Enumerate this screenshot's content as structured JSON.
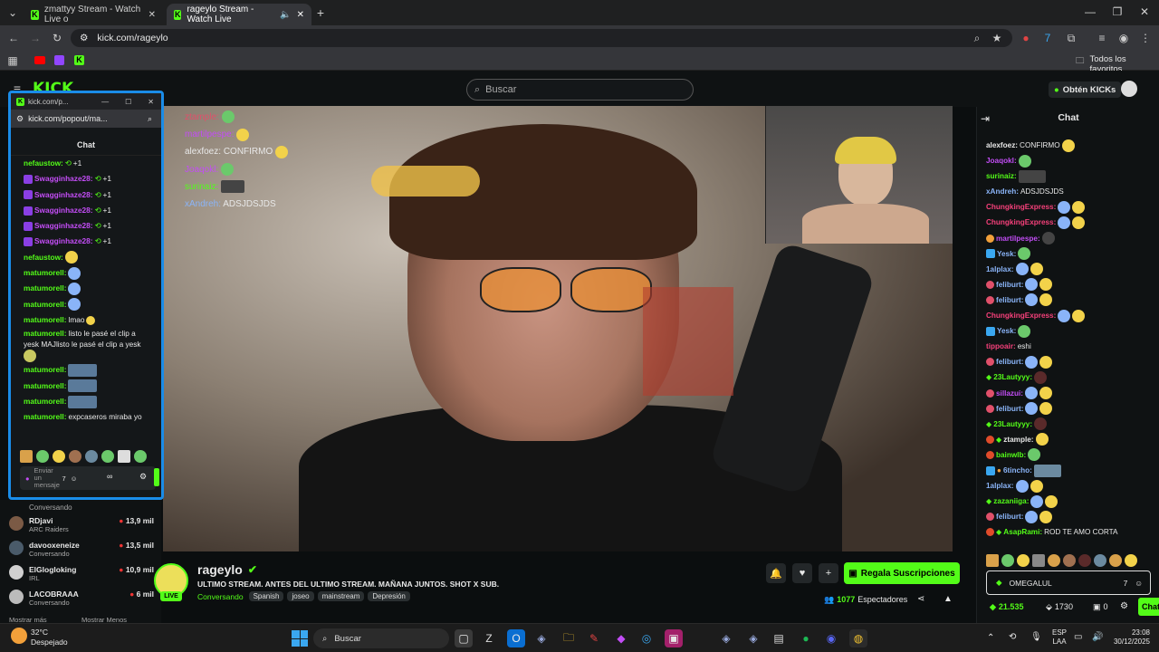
{
  "browser": {
    "tabs": [
      {
        "title": "zmattyy Stream - Watch Live o"
      },
      {
        "title": "rageylo Stream - Watch Live"
      }
    ],
    "url": "kick.com/rageylo",
    "favorites_label": "Todos los favoritos"
  },
  "site": {
    "search_placeholder": "Buscar",
    "get_kicks_label": "Obtén KICKs",
    "logo_text": "KICK"
  },
  "popout": {
    "title": "kick.com/p...",
    "url": "kick.com/popout/ma...",
    "chat_header": "Chat",
    "messages": [
      {
        "user": "nefaustow:",
        "color": "#53fc18",
        "text": "+1",
        "badge": false
      },
      {
        "user": "Swagginhaze28:",
        "color": "#c34df6",
        "text": "+1",
        "badge": true
      },
      {
        "user": "Swagginhaze28:",
        "color": "#c34df6",
        "text": "+1",
        "badge": true
      },
      {
        "user": "Swagginhaze28:",
        "color": "#c34df6",
        "text": "+1",
        "badge": true
      },
      {
        "user": "Swagginhaze28:",
        "color": "#c34df6",
        "text": "+1",
        "badge": true
      },
      {
        "user": "Swagginhaze28:",
        "color": "#c34df6",
        "text": "+1",
        "badge": true
      },
      {
        "user": "nefaustow:",
        "color": "#53fc18",
        "text": "",
        "badge": false
      },
      {
        "user": "matumorell:",
        "color": "#53fc18",
        "text": "",
        "badge": false
      },
      {
        "user": "matumorell:",
        "color": "#53fc18",
        "text": "",
        "badge": false
      },
      {
        "user": "matumorell:",
        "color": "#53fc18",
        "text": "",
        "badge": false
      },
      {
        "user": "matumorell:",
        "color": "#53fc18",
        "text": "lmao",
        "badge": false
      },
      {
        "user": "matumorell:",
        "color": "#53fc18",
        "text": "listo le pasé el clip a",
        "badge": false
      },
      {
        "user": "",
        "color": "#53fc18",
        "text": "yesk MAJlisto le pasé el clip a yesk",
        "badge": false
      },
      {
        "user": "",
        "color": "#53fc18",
        "text": "",
        "badge": false
      },
      {
        "user": "matumorell:",
        "color": "#53fc18",
        "text": "",
        "badge": false
      },
      {
        "user": "matumorell:",
        "color": "#53fc18",
        "text": "",
        "badge": false
      },
      {
        "user": "matumorell:",
        "color": "#53fc18",
        "text": "",
        "badge": false
      },
      {
        "user": "matumorell:",
        "color": "#53fc18",
        "text": "expcaseros miraba yo",
        "badge": false
      }
    ],
    "input_placeholder": "Enviar un mensaje"
  },
  "overlay_chat": [
    {
      "user": "ztample:",
      "color": "#e0506a",
      "text": ""
    },
    {
      "user": "martilpespe:",
      "color": "#c34df6",
      "text": ""
    },
    {
      "user": "alexfoez:",
      "color": "#e8e8e8",
      "text": "CONFIRMO"
    },
    {
      "user": "Joaqokl:",
      "color": "#c34df6",
      "text": ""
    },
    {
      "user": "surinaiz:",
      "color": "#53fc18",
      "text": ""
    },
    {
      "user": "xAndreh:",
      "color": "#8ab4f8",
      "text": "ADSJDSJDS"
    }
  ],
  "sidebar": {
    "channels": [
      {
        "name": "",
        "category": "Conversando",
        "viewers": ""
      },
      {
        "name": "RDjavi",
        "category": "ARC Raiders",
        "viewers": "13,9 mil"
      },
      {
        "name": "davooxeneize",
        "category": "Conversando",
        "viewers": "13,5 mil"
      },
      {
        "name": "ElGlogloking",
        "category": "IRL",
        "viewers": "10,9 mil"
      },
      {
        "name": "LACOBRAAA",
        "category": "Conversando",
        "viewers": "6 mil"
      }
    ],
    "show_more": "Mostrar más",
    "show_less": "Mostrar Menos"
  },
  "stream": {
    "streamer": "rageylo",
    "live_badge": "LIVE",
    "title": "ULTIMO STREAM. ANTES DEL ULTIMO STREAM. MAÑANA JUNTOS. SHOT X SUB.",
    "category": "Conversando",
    "tags": [
      "Spanish",
      "joseo",
      "mainstream",
      "Depresión"
    ],
    "gift_label": "Regala Suscripciones",
    "viewers_count": "1077",
    "viewers_label": "Espectadores"
  },
  "chat": {
    "header": "Chat",
    "messages": [
      {
        "user": "alexfoez:",
        "color": "#e8e8e8",
        "text": "CONFIRMO"
      },
      {
        "user": "Joaqokl:",
        "color": "#c34df6",
        "text": ""
      },
      {
        "user": "surinaiz:",
        "color": "#53fc18",
        "text": ""
      },
      {
        "user": "xAndreh:",
        "color": "#8ab4f8",
        "text": "ADSJDSJDS"
      },
      {
        "user": "ChungkingExpress:",
        "color": "#f5407a",
        "text": ""
      },
      {
        "user": "ChungkingExpress:",
        "color": "#f5407a",
        "text": ""
      },
      {
        "user": "martilpespe:",
        "color": "#c34df6",
        "text": ""
      },
      {
        "user": "Yesk:",
        "color": "#8ab4f8",
        "text": ""
      },
      {
        "user": "1alplax:",
        "color": "#8ab4f8",
        "text": ""
      },
      {
        "user": "feliburt:",
        "color": "#8ab4f8",
        "text": ""
      },
      {
        "user": "feliburt:",
        "color": "#8ab4f8",
        "text": ""
      },
      {
        "user": "ChungkingExpress:",
        "color": "#f5407a",
        "text": ""
      },
      {
        "user": "Yesk:",
        "color": "#8ab4f8",
        "text": ""
      },
      {
        "user": "tippoair:",
        "color": "#f5407a",
        "text": "eshi"
      },
      {
        "user": "feliburt:",
        "color": "#8ab4f8",
        "text": ""
      },
      {
        "user": "23Lautyyy:",
        "color": "#53fc18",
        "text": ""
      },
      {
        "user": "sillazui:",
        "color": "#c34df6",
        "text": ""
      },
      {
        "user": "feliburt:",
        "color": "#8ab4f8",
        "text": ""
      },
      {
        "user": "23Lautyyy:",
        "color": "#53fc18",
        "text": ""
      },
      {
        "user": "ztample:",
        "color": "#e8e8e8",
        "text": ""
      },
      {
        "user": "bainwlb:",
        "color": "#53fc18",
        "text": ""
      },
      {
        "user": "6tincho:",
        "color": "#8ab4f8",
        "text": ""
      },
      {
        "user": "1alplax:",
        "color": "#8ab4f8",
        "text": ""
      },
      {
        "user": "zazaniiga:",
        "color": "#53fc18",
        "text": ""
      },
      {
        "user": "feliburt:",
        "color": "#8ab4f8",
        "text": ""
      },
      {
        "user": "AsapRami:",
        "color": "#53fc18",
        "text": "ROD TE AMO CORTA"
      }
    ],
    "input_value": "OMEGALUL",
    "kicks_balance": "21.535",
    "points": "1730",
    "gifts": "0",
    "send_label": "Chat"
  },
  "taskbar": {
    "weather_temp": "32°C",
    "weather_desc": "Despejado",
    "search_placeholder": "Buscar",
    "lang_top": "ESP",
    "lang_bottom": "LAA",
    "time": "23:08",
    "date": "30/12/2025"
  },
  "colors": {
    "kick_green": "#53fc18",
    "popout_border": "#1a8ce8",
    "bg": "#0b0e0f"
  }
}
